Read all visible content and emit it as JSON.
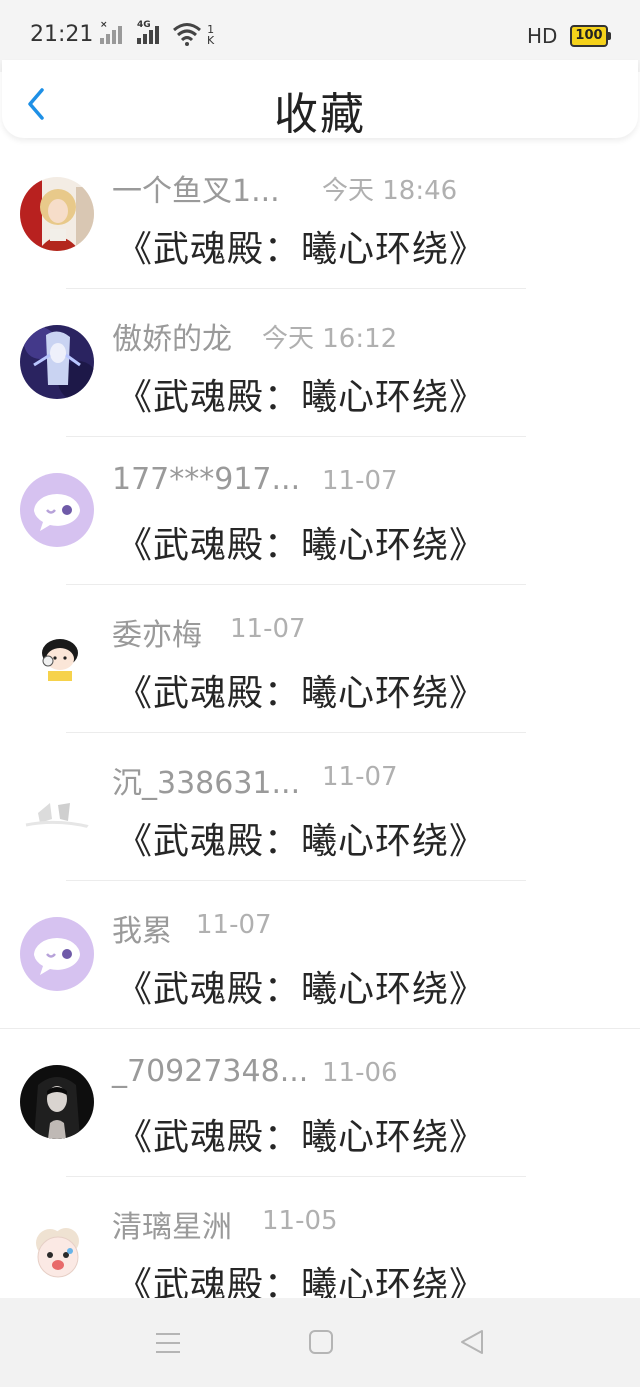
{
  "status_bar": {
    "time": "21:21",
    "signal1_tag": "×",
    "signal2_tag": "4G",
    "speed_value": "1",
    "speed_unit": "K",
    "hd_label": "HD",
    "battery": "100"
  },
  "header": {
    "title": "收藏",
    "back_icon": "chevron-left-icon"
  },
  "items": [
    {
      "name": "一个鱼叉1...",
      "time": "今天 18:46",
      "book": "《武魂殿：曦心环绕》"
    },
    {
      "name": "傲娇的龙",
      "time": "今天 16:12",
      "book": "《武魂殿：曦心环绕》"
    },
    {
      "name": "177***917...",
      "time": "11-07",
      "book": "《武魂殿：曦心环绕》"
    },
    {
      "name": "委亦梅",
      "time": "11-07",
      "book": "《武魂殿：曦心环绕》"
    },
    {
      "name": "沉_338631...",
      "time": "11-07",
      "book": "《武魂殿：曦心环绕》"
    },
    {
      "name": "我累",
      "time": "11-07",
      "book": "《武魂殿：曦心环绕》"
    },
    {
      "name": "_70927348...",
      "time": "11-06",
      "book": "《武魂殿：曦心环绕》"
    },
    {
      "name": "清璃星洲",
      "time": "11-05",
      "book": "《武魂殿：曦心环绕》"
    }
  ],
  "nav_bar": {
    "menu_icon": "menu-icon",
    "home_icon": "home-square-icon",
    "back_icon": "back-triangle-icon"
  },
  "colors": {
    "accent": "#1e90e6",
    "default_avatar": "#d6c2f0"
  }
}
